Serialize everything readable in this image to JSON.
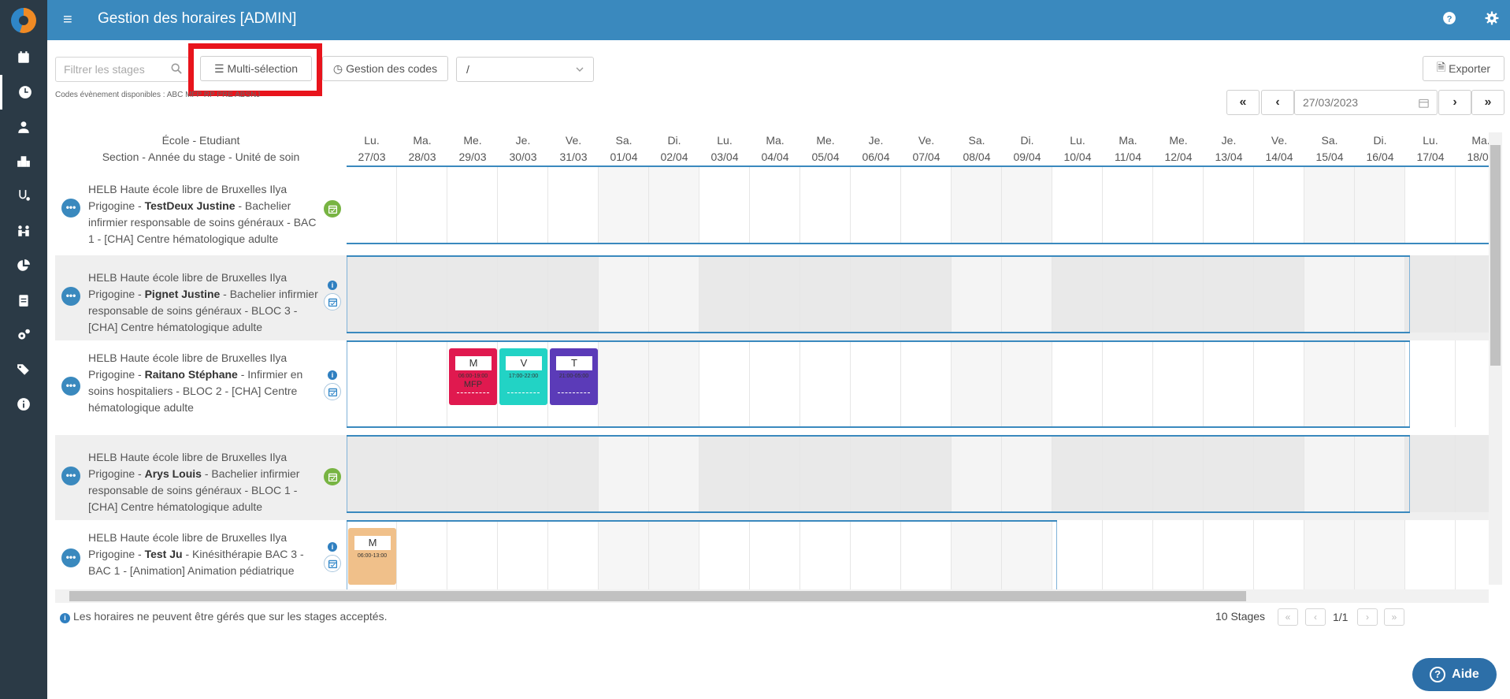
{
  "app": {
    "title": "Gestion des horaires [ADMIN]"
  },
  "sidebar": {
    "items": [
      "calendar-icon",
      "clock-icon",
      "nurse-icon",
      "hospital-icon",
      "stethoscope-icon",
      "people-icon",
      "pie-chart-icon",
      "clipboard-icon",
      "cogs-icon",
      "tags-icon",
      "info-icon"
    ]
  },
  "toolbar": {
    "filter_placeholder": "Filtrer les stages",
    "multi_selection_label": "Multi-sélection",
    "codes_management_label": "Gestion des codes",
    "select_value": "/",
    "export_label": "Exporter",
    "codes_available": "Codes évènement disponibles : ABC MFP RP PRE ABSNJ",
    "date_value": "27/03/2023"
  },
  "grid": {
    "header_left_line1": "École - Etudiant",
    "header_left_line2": "Section - Année du stage - Unité de soin",
    "days": [
      {
        "d": "Lu.",
        "n": "27/03"
      },
      {
        "d": "Ma.",
        "n": "28/03"
      },
      {
        "d": "Me.",
        "n": "29/03"
      },
      {
        "d": "Je.",
        "n": "30/03"
      },
      {
        "d": "Ve.",
        "n": "31/03"
      },
      {
        "d": "Sa.",
        "n": "01/04"
      },
      {
        "d": "Di.",
        "n": "02/04"
      },
      {
        "d": "Lu.",
        "n": "03/04"
      },
      {
        "d": "Ma.",
        "n": "04/04"
      },
      {
        "d": "Me.",
        "n": "05/04"
      },
      {
        "d": "Je.",
        "n": "06/04"
      },
      {
        "d": "Ve.",
        "n": "07/04"
      },
      {
        "d": "Sa.",
        "n": "08/04"
      },
      {
        "d": "Di.",
        "n": "09/04"
      },
      {
        "d": "Lu.",
        "n": "10/04"
      },
      {
        "d": "Ma.",
        "n": "11/04"
      },
      {
        "d": "Me.",
        "n": "12/04"
      },
      {
        "d": "Je.",
        "n": "13/04"
      },
      {
        "d": "Ve.",
        "n": "14/04"
      },
      {
        "d": "Sa.",
        "n": "15/04"
      },
      {
        "d": "Di.",
        "n": "16/04"
      },
      {
        "d": "Lu.",
        "n": "17/04"
      },
      {
        "d": "Ma.",
        "n": "18/04"
      }
    ],
    "rows": [
      {
        "pre": "HELB Haute école libre de Bruxelles Ilya Prigogine - ",
        "name": "TestDeux Justine",
        "post": " - Bachelier infirmier responsable de soins généraux - BAC 1 - [CHA] Centre hématologique adulte"
      },
      {
        "pre": "HELB Haute école libre de Bruxelles Ilya Prigogine - ",
        "name": "Pignet Justine",
        "post": " - Bachelier infirmier responsable de soins généraux - BLOC 3 - [CHA] Centre hématologique adulte"
      },
      {
        "pre": "HELB Haute école libre de Bruxelles Ilya Prigogine - ",
        "name": "Raitano Stéphane",
        "post": " - Infirmier en soins hospitaliers - BLOC 2 - [CHA] Centre hématologique adulte"
      },
      {
        "pre": "HELB Haute école libre de Bruxelles Ilya Prigogine - ",
        "name": "Arys Louis",
        "post": " - Bachelier infirmier responsable de soins généraux - BLOC 1 - [CHA] Centre hématologique adulte"
      },
      {
        "pre": "HELB Haute école libre de Bruxelles Ilya Prigogine - ",
        "name": "Test Ju",
        "post": " - Kinésithérapie BAC 3 - BAC 1 - [Animation] Animation pédiatrique"
      }
    ],
    "shifts": [
      {
        "code": "M",
        "hours": "06:00-19:00",
        "sub": "MFP",
        "color": "#e0194f"
      },
      {
        "code": "V",
        "hours": "17:00-22:00",
        "sub": "",
        "color": "#22d3c5"
      },
      {
        "code": "T",
        "hours": "21:00-05:00",
        "sub": "",
        "color": "#5b3bb8"
      },
      {
        "code": "M",
        "hours": "06:00-13:00",
        "sub": "",
        "color": "#f0c08a"
      }
    ]
  },
  "footer": {
    "note": "Les horaires ne peuvent être gérés que sur les stages acceptés.",
    "stages_count": "10 Stages",
    "page": "1/1",
    "help_label": "Aide"
  }
}
